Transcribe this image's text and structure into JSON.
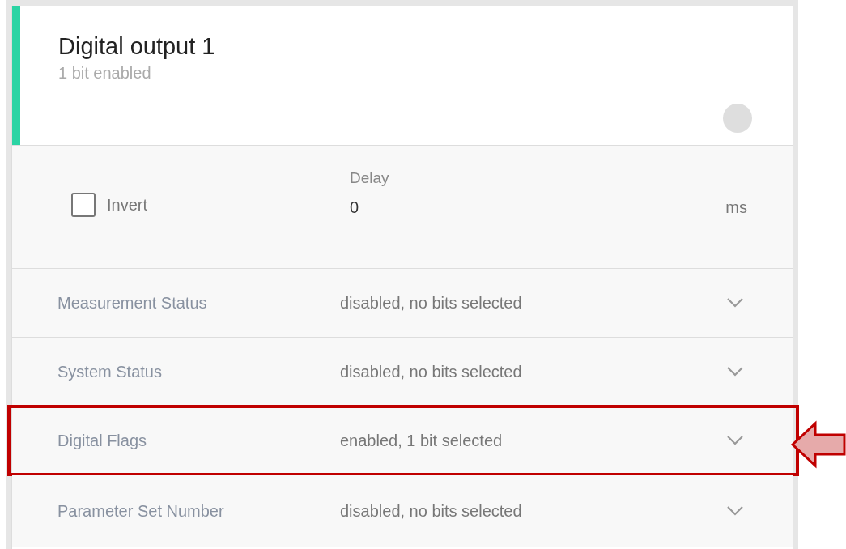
{
  "card": {
    "title": "Digital output 1",
    "subtitle": "1 bit enabled",
    "status_on": false
  },
  "settings": {
    "invert": {
      "label": "Invert",
      "checked": false
    },
    "delay": {
      "label": "Delay",
      "value": "0",
      "unit": "ms"
    }
  },
  "rows": [
    {
      "label": "Measurement Status",
      "value": "disabled, no bits selected",
      "expanded": false,
      "highlighted": false
    },
    {
      "label": "System Status",
      "value": "disabled, no bits selected",
      "expanded": false,
      "highlighted": false
    },
    {
      "label": "Digital Flags",
      "value": "enabled, 1 bit selected",
      "expanded": false,
      "highlighted": true
    },
    {
      "label": "Parameter Set Number",
      "value": "disabled, no bits selected",
      "expanded": false,
      "highlighted": false
    }
  ]
}
